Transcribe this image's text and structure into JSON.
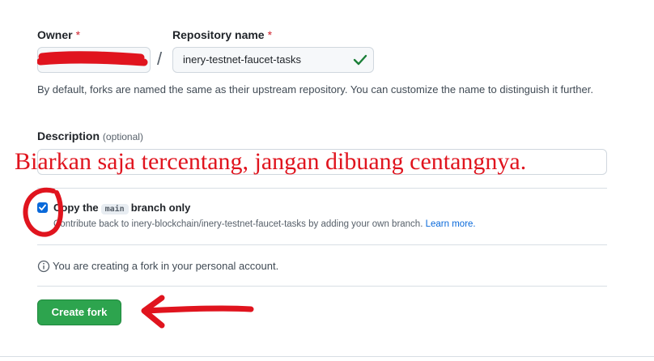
{
  "owner": {
    "label": "Owner",
    "required_mark": "*"
  },
  "repository": {
    "label": "Repository name",
    "required_mark": "*",
    "separator": "/",
    "value": "inery-testnet-faucet-tasks"
  },
  "default_hint": "By default, forks are named the same as their upstream repository. You can customize the name to distinguish it further.",
  "description": {
    "label": "Description",
    "optional": "(optional)"
  },
  "annotation_text": "Biarkan saja tercentang, jangan dibuang centangnya.",
  "copy_branch": {
    "checked": true,
    "label_prefix": "Copy the",
    "branch": "main",
    "label_suffix": "branch only",
    "sub_text": "Contribute back to inery-blockchain/inery-testnet-faucet-tasks by adding your own branch.",
    "learn_more": "Learn more."
  },
  "fork_info": "You are creating a fork in your personal account.",
  "create_button": "Create fork",
  "colors": {
    "primary_button": "#2da44e",
    "annotation_red": "#e0141e",
    "link": "#0969da",
    "check_green": "#1a7f37"
  },
  "icons": [
    "check-icon",
    "info-icon"
  ]
}
